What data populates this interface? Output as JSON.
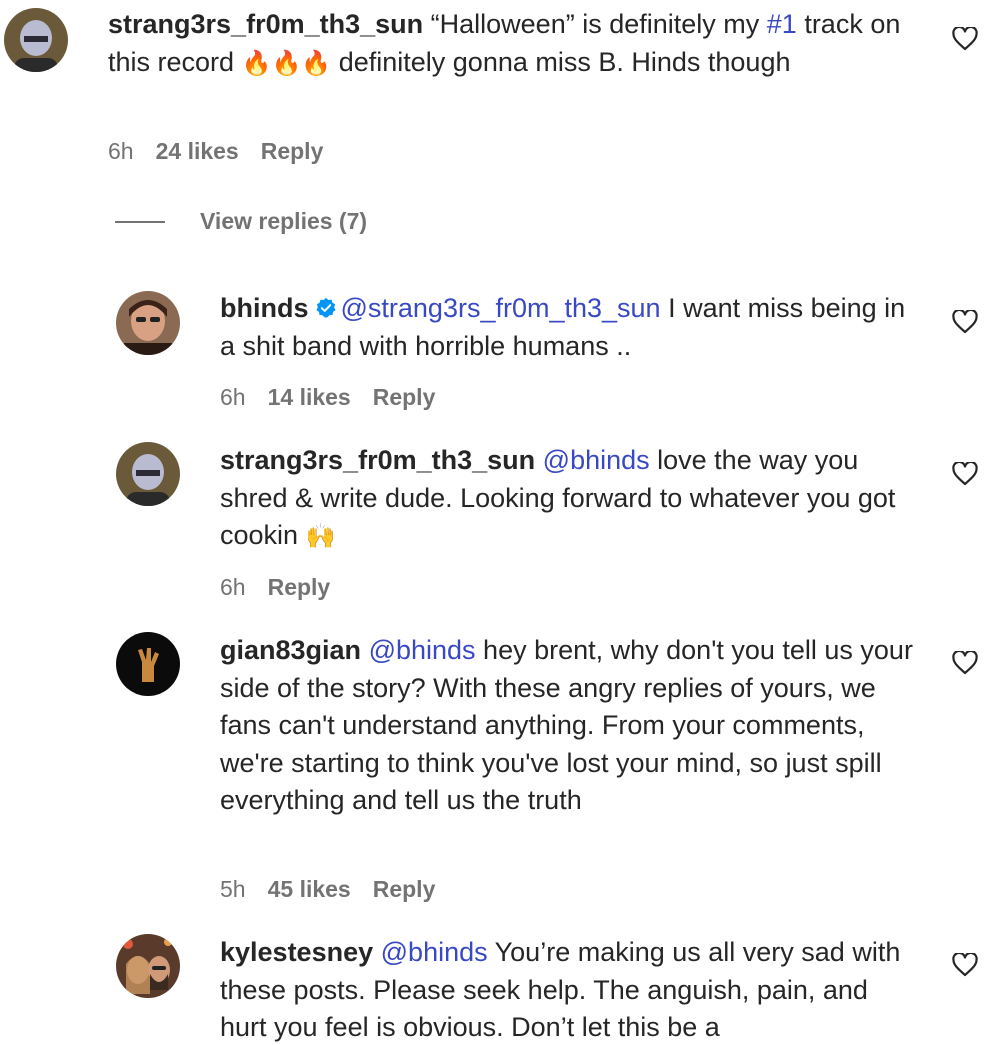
{
  "comments": [
    {
      "username": "strang3rs_fr0m_th3_sun",
      "text_a": " “Halloween” is definitely my ",
      "hashtag": "#1",
      "text_b": " track on this record ",
      "emoji": "🔥🔥🔥",
      "text_c": " definitely gonna miss B. Hinds though",
      "time": "6h",
      "likes": "24 likes",
      "reply": "Reply"
    },
    {
      "username": "bhinds",
      "mention": "@strang3rs_fr0m_th3_sun",
      "text": " I want miss being in a shit band with horrible humans ..",
      "time": "6h",
      "likes": "14 likes",
      "reply": "Reply"
    },
    {
      "username": "strang3rs_fr0m_th3_sun",
      "mention": "@bhinds",
      "text": " love the way you shred & write dude. Looking forward to whatever you got cookin ",
      "emoji": "🙌",
      "time": "6h",
      "reply": "Reply"
    },
    {
      "username": "gian83gian",
      "mention": "@bhinds",
      "text": " hey brent, why don't you tell us your side of the story? With these angry replies of yours, we fans can't understand anything. From your comments, we're starting to think you've lost your mind, so just spill everything and tell us the truth",
      "time": "5h",
      "likes": "45 likes",
      "reply": "Reply"
    },
    {
      "username": "kylestesney",
      "mention": "@bhinds",
      "text": " You’re making us all very sad with these posts. Please seek help. The anguish, pain, and hurt you feel is obvious. Don’t let this be a"
    }
  ],
  "view_replies": "View replies (7)",
  "icons": {
    "heart": "heart-outline-icon",
    "verified": "verified-badge-icon"
  },
  "colors": {
    "text": "#262626",
    "meta": "#737373",
    "mention": "#3949c4",
    "verified": "#0095f6"
  }
}
